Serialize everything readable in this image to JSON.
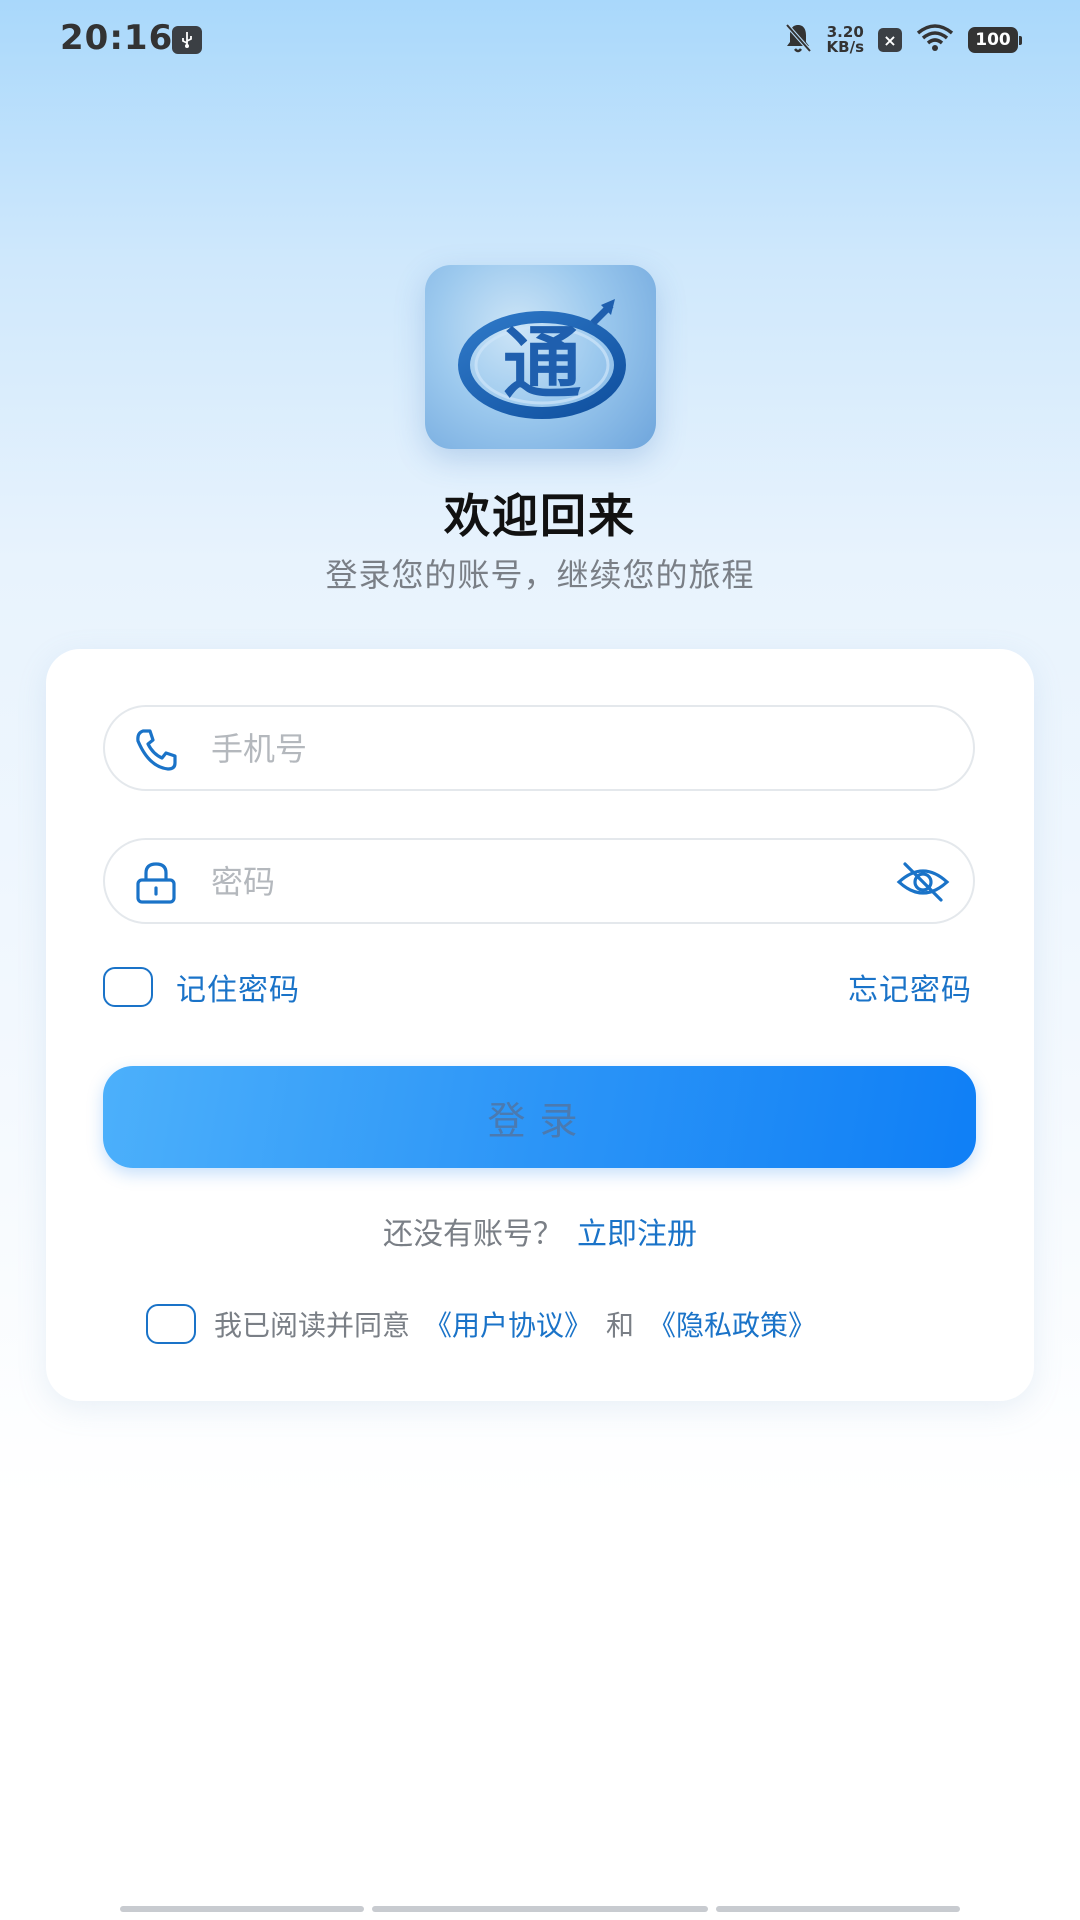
{
  "status_bar": {
    "time": "20:16",
    "net_speed_value": "3.20",
    "net_speed_unit": "KB/s",
    "sim_status": "×",
    "battery": "100",
    "icons": [
      "usb-debug-icon",
      "bell-muted-icon",
      "sim-off-icon",
      "wifi-icon",
      "battery-icon"
    ]
  },
  "header": {
    "logo_text": "通",
    "title": "欢迎回来",
    "subtitle": "登录您的账号，继续您的旅程"
  },
  "form": {
    "phone_placeholder": "手机号",
    "phone_value": "",
    "password_placeholder": "密码",
    "password_value": "",
    "remember_label": "记住密码",
    "remember_checked": false,
    "forgot_label": "忘记密码",
    "login_label": "登录",
    "no_account_text": "还没有账号？",
    "register_link": "立即注册",
    "agree_text": "我已阅读并同意",
    "user_agreement": "《用户协议》",
    "and_text": "和",
    "privacy_policy": "《隐私政策》",
    "agree_checked": false
  },
  "colors": {
    "accent": "#1a73c8",
    "button_start": "#4cb0fb",
    "button_end": "#0f7ff6",
    "muted_text": "#7a7f86"
  }
}
